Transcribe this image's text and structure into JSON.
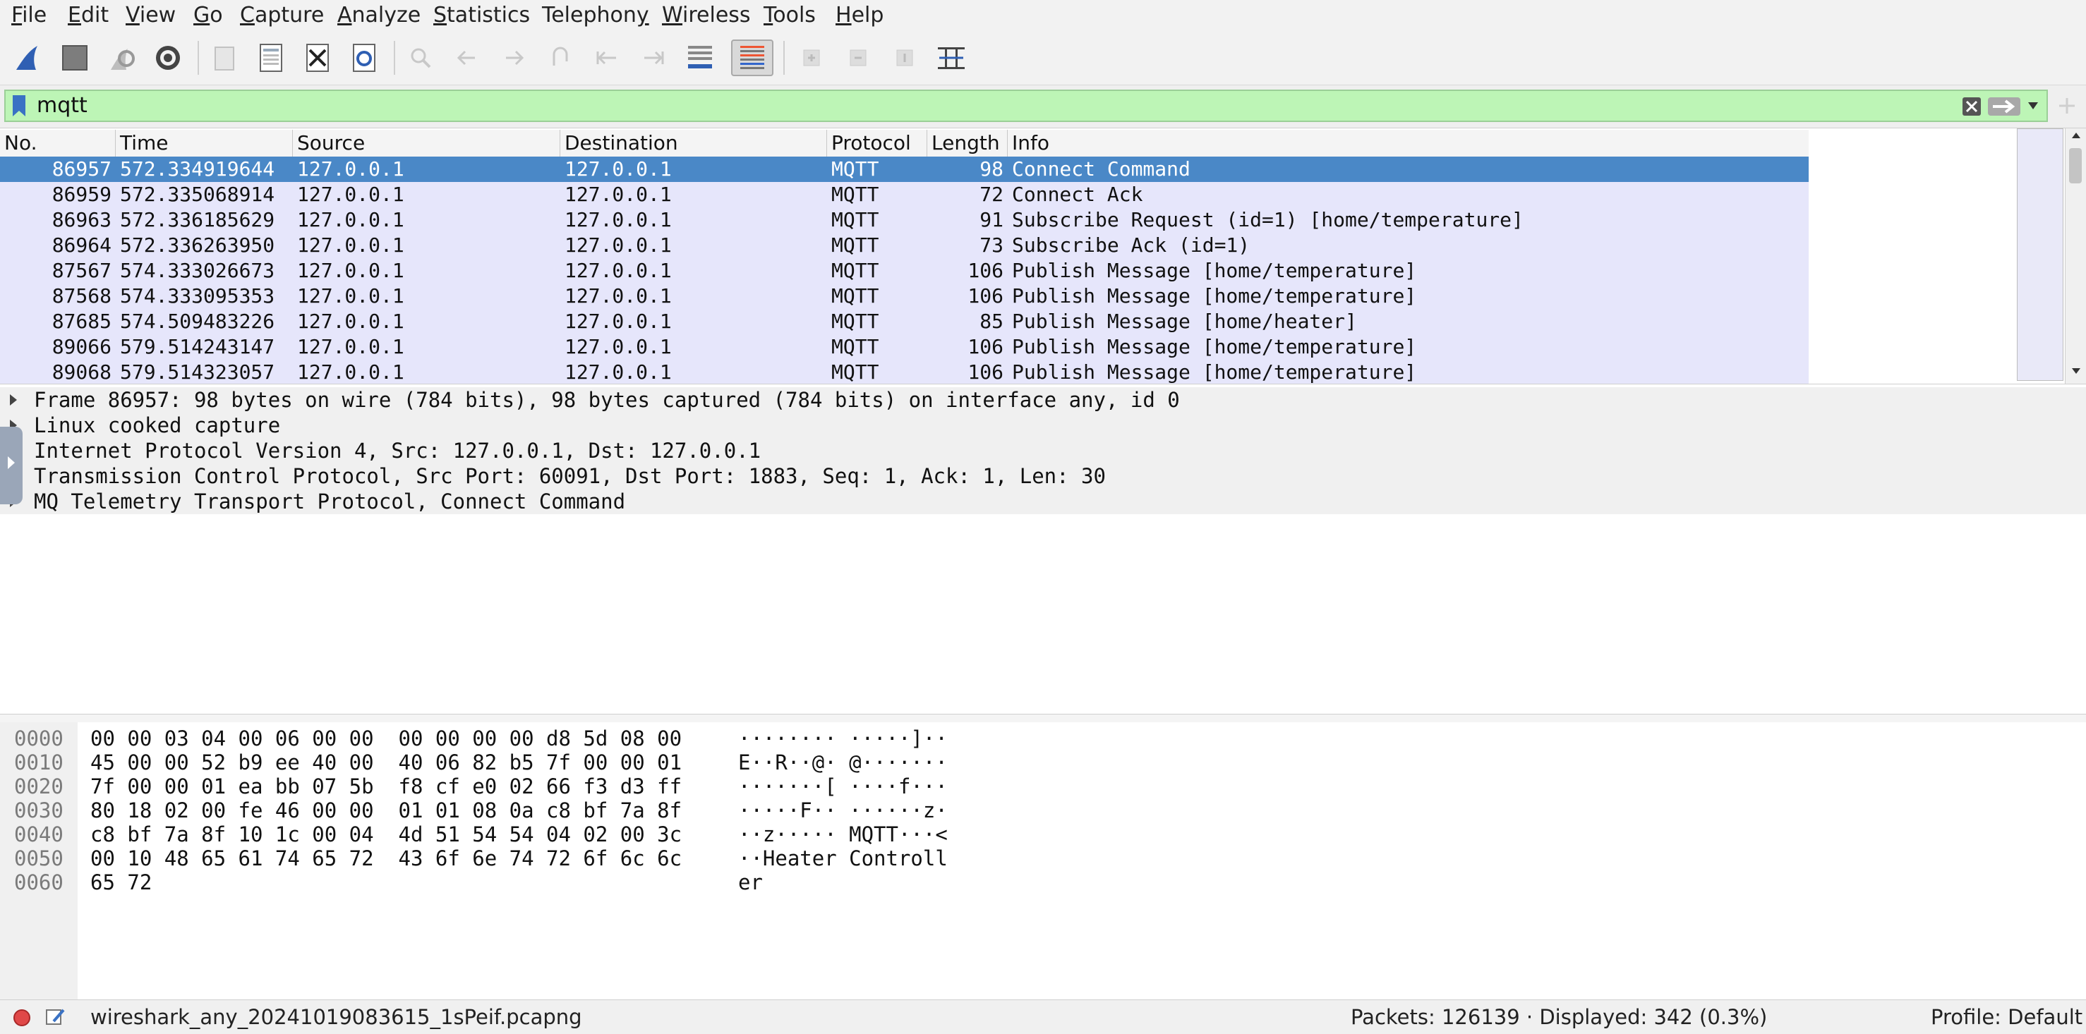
{
  "menu": [
    {
      "pre": "",
      "u": "F",
      "post": "ile"
    },
    {
      "pre": "",
      "u": "E",
      "post": "dit"
    },
    {
      "pre": "",
      "u": "V",
      "post": "iew"
    },
    {
      "pre": "",
      "u": "G",
      "post": "o"
    },
    {
      "pre": "",
      "u": "C",
      "post": "apture"
    },
    {
      "pre": "",
      "u": "A",
      "post": "nalyze"
    },
    {
      "pre": "",
      "u": "S",
      "post": "tatistics"
    },
    {
      "pre": "Telephon",
      "u": "y",
      "post": ""
    },
    {
      "pre": "",
      "u": "W",
      "post": "ireless"
    },
    {
      "pre": "",
      "u": "T",
      "post": "ools"
    },
    {
      "pre": "",
      "u": "H",
      "post": "elp"
    }
  ],
  "toolbar": {
    "icons": [
      "shark-fin-start-icon",
      "stop-square-icon",
      "restart-capture-icon",
      "capture-options-gear-icon",
      "open-file-icon",
      "save-file-icon",
      "close-file-icon",
      "reload-file-icon",
      "find-packet-icon",
      "go-back-icon",
      "go-forward-icon",
      "go-to-packet-icon",
      "go-first-icon",
      "go-last-icon",
      "autoscroll-icon",
      "colorize-icon",
      "zoom-in-icon",
      "zoom-out-icon",
      "normal-size-icon",
      "resize-columns-icon"
    ]
  },
  "filter": {
    "value": "mqtt"
  },
  "columns": [
    "No.",
    "Time",
    "Source",
    "Destination",
    "Protocol",
    "Length",
    "Info"
  ],
  "packets": [
    {
      "no": "86957",
      "time": "572.334919644",
      "src": "127.0.0.1",
      "dst": "127.0.0.1",
      "proto": "MQTT",
      "len": "98",
      "info": "Connect Command",
      "selected": true
    },
    {
      "no": "86959",
      "time": "572.335068914",
      "src": "127.0.0.1",
      "dst": "127.0.0.1",
      "proto": "MQTT",
      "len": "72",
      "info": "Connect Ack",
      "selected": false
    },
    {
      "no": "86963",
      "time": "572.336185629",
      "src": "127.0.0.1",
      "dst": "127.0.0.1",
      "proto": "MQTT",
      "len": "91",
      "info": "Subscribe Request (id=1) [home/temperature]",
      "selected": false
    },
    {
      "no": "86964",
      "time": "572.336263950",
      "src": "127.0.0.1",
      "dst": "127.0.0.1",
      "proto": "MQTT",
      "len": "73",
      "info": "Subscribe Ack (id=1)",
      "selected": false
    },
    {
      "no": "87567",
      "time": "574.333026673",
      "src": "127.0.0.1",
      "dst": "127.0.0.1",
      "proto": "MQTT",
      "len": "106",
      "info": "Publish Message [home/temperature]",
      "selected": false
    },
    {
      "no": "87568",
      "time": "574.333095353",
      "src": "127.0.0.1",
      "dst": "127.0.0.1",
      "proto": "MQTT",
      "len": "106",
      "info": "Publish Message [home/temperature]",
      "selected": false
    },
    {
      "no": "87685",
      "time": "574.509483226",
      "src": "127.0.0.1",
      "dst": "127.0.0.1",
      "proto": "MQTT",
      "len": "85",
      "info": "Publish Message [home/heater]",
      "selected": false
    },
    {
      "no": "89066",
      "time": "579.514243147",
      "src": "127.0.0.1",
      "dst": "127.0.0.1",
      "proto": "MQTT",
      "len": "106",
      "info": "Publish Message [home/temperature]",
      "selected": false
    },
    {
      "no": "89068",
      "time": "579.514323057",
      "src": "127.0.0.1",
      "dst": "127.0.0.1",
      "proto": "MQTT",
      "len": "106",
      "info": "Publish Message [home/temperature]",
      "selected": false
    }
  ],
  "details": [
    "Frame 86957: 98 bytes on wire (784 bits), 98 bytes captured (784 bits) on interface any, id 0",
    "Linux cooked capture",
    "Internet Protocol Version 4, Src: 127.0.0.1, Dst: 127.0.0.1",
    "Transmission Control Protocol, Src Port: 60091, Dst Port: 1883, Seq: 1, Ack: 1, Len: 30",
    "MQ Telemetry Transport Protocol, Connect Command"
  ],
  "bytes": [
    {
      "off": "0000",
      "hex": "00 00 03 04 00 06 00 00  00 00 00 00 d8 5d 08 00",
      "ascii": "········ ·····]··"
    },
    {
      "off": "0010",
      "hex": "45 00 00 52 b9 ee 40 00  40 06 82 b5 7f 00 00 01",
      "ascii": "E··R··@· @·······"
    },
    {
      "off": "0020",
      "hex": "7f 00 00 01 ea bb 07 5b  f8 cf e0 02 66 f3 d3 ff",
      "ascii": "·······[ ····f···"
    },
    {
      "off": "0030",
      "hex": "80 18 02 00 fe 46 00 00  01 01 08 0a c8 bf 7a 8f",
      "ascii": "·····F·· ······z·"
    },
    {
      "off": "0040",
      "hex": "c8 bf 7a 8f 10 1c 00 04  4d 51 54 54 04 02 00 3c",
      "ascii": "··z····· MQTT···<"
    },
    {
      "off": "0050",
      "hex": "00 10 48 65 61 74 65 72  43 6f 6e 74 72 6f 6c 6c",
      "ascii": "··Heater Controll"
    },
    {
      "off": "0060",
      "hex": "65 72",
      "ascii": "er"
    }
  ],
  "status": {
    "file": "wireshark_any_20241019083615_1sPeif.pcapng",
    "packets": "Packets: 126139 · Displayed: 342 (0.3%)",
    "profile": "Profile: Default"
  },
  "colors": {
    "selected_row": "#4a88c7",
    "packet_row": "#e6e6fb",
    "filter_bg": "#bdf5b6"
  }
}
